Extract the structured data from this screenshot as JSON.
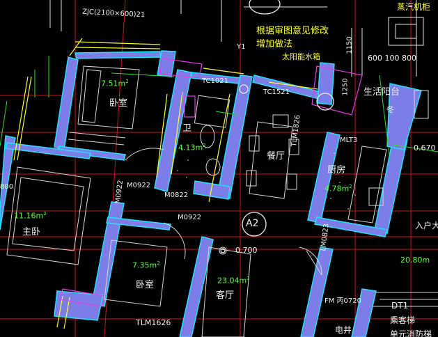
{
  "colors": {
    "background": "#000000",
    "wall": "#7d7de8",
    "wall_outline": "#22e0ff",
    "axis": "#c21a1a",
    "window_line": "#ffff33",
    "area_text": "#5dff3c",
    "note_text": "#ffff33",
    "magenta": "#e040e0"
  },
  "notes": {
    "revision_line1": "根据审图意见修改",
    "revision_line2": "增加做法",
    "top_left_code": "ZJC(2100×600)21",
    "y1": "Y1",
    "solar_tank": "太阳能水箱",
    "top_right_fixture": "蒸汽机柜",
    "dims_row": "600 100 800",
    "dim_vertical_1": "1250",
    "dim_vertical_2": "1150"
  },
  "rooms": {
    "bedroom_top": {
      "name": "卧室",
      "area": "7.51m",
      "area_sup": "2"
    },
    "bathroom": {
      "name": "卫",
      "area": "4.13m",
      "area_sup": "2"
    },
    "dining": {
      "name": "餐厅"
    },
    "kitchen": {
      "name": "厨房",
      "area": "4.78m",
      "area_sup": "2"
    },
    "balcony": {
      "name": "生活阳台",
      "extra": "冬"
    },
    "master_bedroom": {
      "name": "主卧",
      "area": "11.16m",
      "area_sup": "2"
    },
    "bedroom_bottom": {
      "name": "卧室",
      "area": "7.35m",
      "area_sup": "2"
    },
    "living": {
      "name": "客厅",
      "area": "23.04m",
      "area_sup": "2"
    },
    "entry": {
      "name": "入户大堂"
    },
    "entry_area": "20.80m",
    "shaft": "电井",
    "elevator": {
      "code": "DT1",
      "name": "乘客梯",
      "sub": "单元消防梯"
    }
  },
  "tags": {
    "tc1021": "TC1021",
    "tc1521": "TC1521",
    "mlt3": "MLT3",
    "tlm1826": "TLM1826",
    "m0922_a": "M0922",
    "m0822": "M0822",
    "m0922_b": "M0922",
    "m0922_c": "M0922",
    "tlm1626": "TLM1626",
    "fm": "FM 丙0720",
    "lm": "LM0823",
    "unit": "A2",
    "elevation": "0.700",
    "elevation_right": "0.670",
    "left_dim": "800"
  }
}
